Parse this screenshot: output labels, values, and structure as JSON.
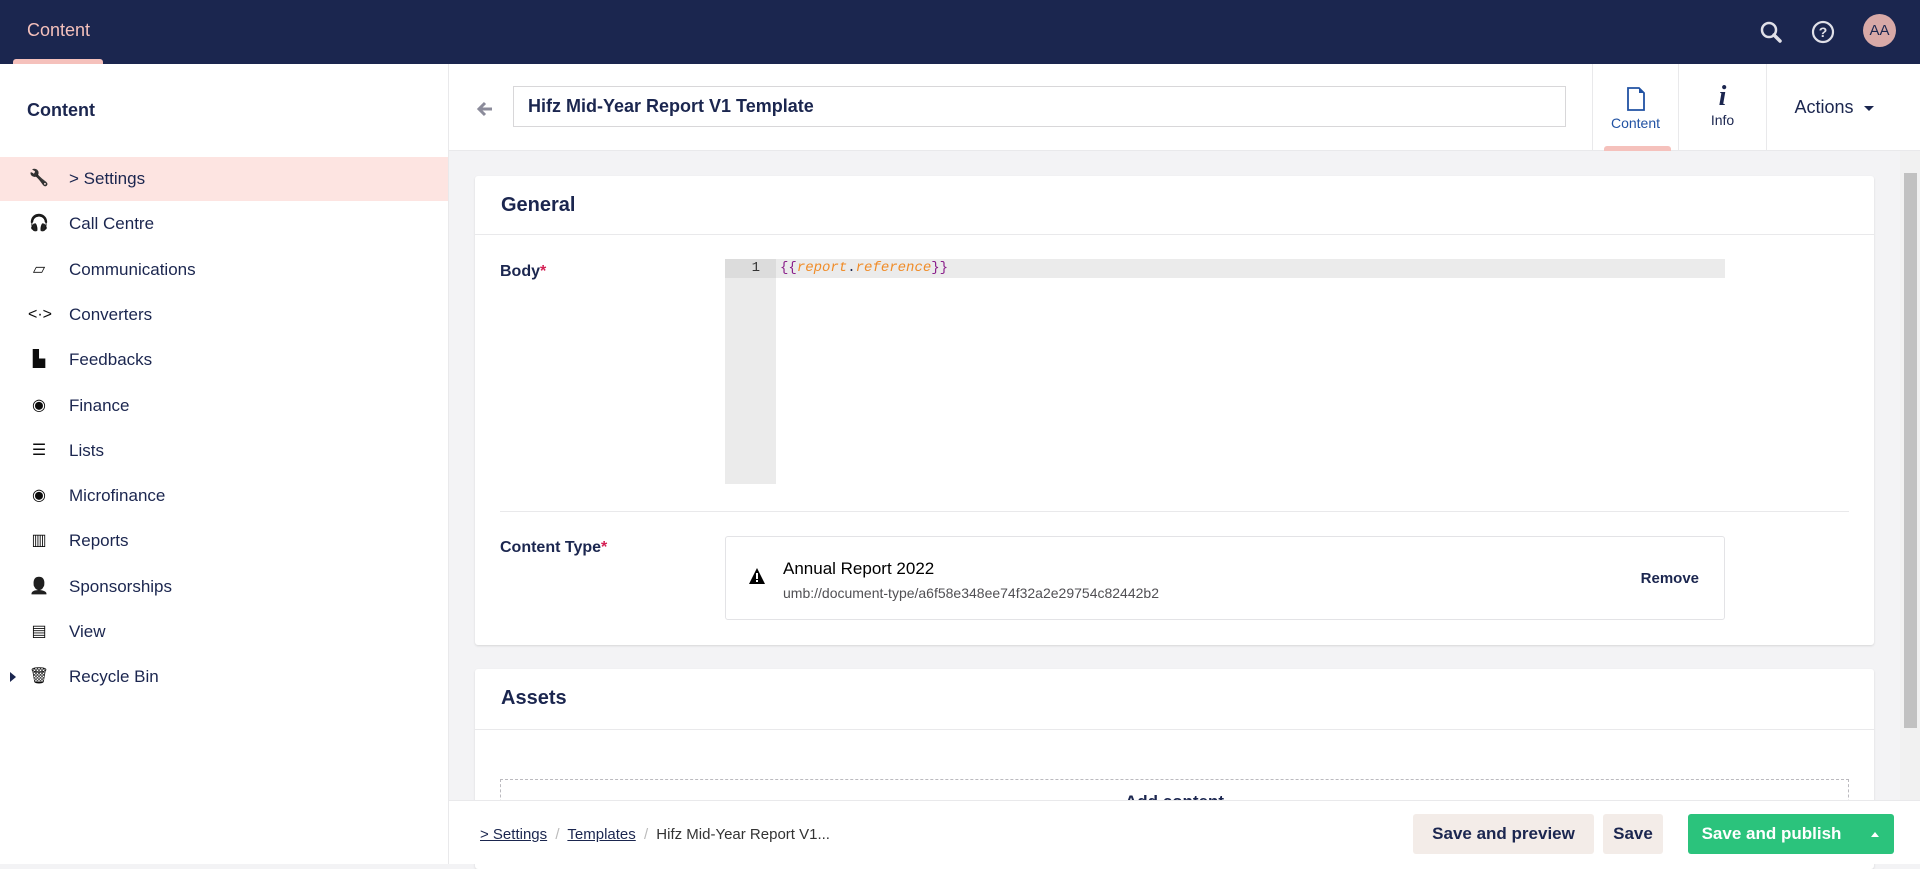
{
  "topbar": {
    "section": "Content",
    "avatar_initials": "AA",
    "icons": [
      "search-icon",
      "help-icon"
    ]
  },
  "sidebar": {
    "title": "Content",
    "items": [
      {
        "label": "> Settings",
        "icon": "wrench-icon",
        "active": true
      },
      {
        "label": "Call Centre",
        "icon": "headset-icon"
      },
      {
        "label": "Communications",
        "icon": "inbox-icon"
      },
      {
        "label": "Converters",
        "icon": "code-arrows-icon"
      },
      {
        "label": "Feedbacks",
        "icon": "megaphone-icon"
      },
      {
        "label": "Finance",
        "icon": "coins-icon"
      },
      {
        "label": "Lists",
        "icon": "ordered-list-icon"
      },
      {
        "label": "Microfinance",
        "icon": "coin-stack-icon"
      },
      {
        "label": "Reports",
        "icon": "books-icon"
      },
      {
        "label": "Sponsorships",
        "icon": "users-icon"
      },
      {
        "label": "View",
        "icon": "newspaper-icon"
      },
      {
        "label": "Recycle Bin",
        "icon": "trash-icon"
      }
    ]
  },
  "editor": {
    "name": "Hifz Mid-Year Report V1 Template",
    "apps": [
      {
        "label": "Content",
        "icon": "document-icon",
        "active": true
      },
      {
        "label": "Info",
        "icon": "info-icon"
      }
    ],
    "actions_label": "Actions"
  },
  "general": {
    "title": "General",
    "body_label": "Body",
    "code_line_number": "1",
    "code": {
      "open": "{{",
      "var": "report",
      "dot": ".",
      "prop": "reference",
      "close": "}}"
    },
    "content_type_label": "Content Type",
    "content_type": {
      "name": "Annual Report 2022",
      "udi": "umb://document-type/a6f58e348ee74f32a2e29754c82442b2",
      "remove_label": "Remove"
    }
  },
  "assets": {
    "title": "Assets",
    "add_content_label": "Add content"
  },
  "footer": {
    "breadcrumb": [
      "> Settings",
      "Templates",
      "Hifz Mid-Year Report V1..."
    ],
    "save_preview": "Save and preview",
    "save": "Save",
    "save_publish": "Save and publish"
  },
  "colors": {
    "header": "#1b264f",
    "accent": "#f5c1bc",
    "publish": "#2bc37c"
  }
}
